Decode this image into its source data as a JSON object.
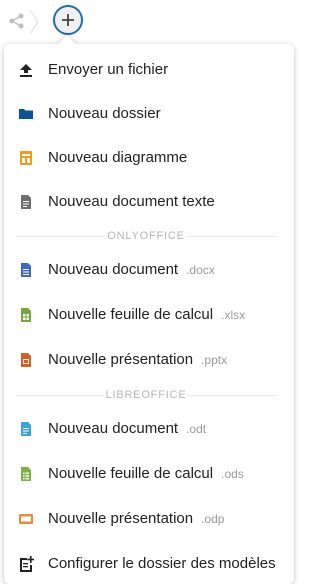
{
  "menu": {
    "items": [
      {
        "label": "Envoyer un fichier",
        "ext": "",
        "icon": "upload-icon"
      },
      {
        "label": "Nouveau dossier",
        "ext": "",
        "icon": "folder-icon"
      },
      {
        "label": "Nouveau diagramme",
        "ext": "",
        "icon": "diagram-icon"
      },
      {
        "label": "Nouveau document texte",
        "ext": "",
        "icon": "text-document-icon"
      }
    ],
    "onlyoffice_header": "ONLYOFFICE",
    "onlyoffice_items": [
      {
        "label": "Nouveau document",
        "ext": ".docx",
        "icon": "document-icon"
      },
      {
        "label": "Nouvelle feuille de calcul",
        "ext": ".xlsx",
        "icon": "spreadsheet-icon"
      },
      {
        "label": "Nouvelle présentation",
        "ext": ".pptx",
        "icon": "presentation-icon"
      }
    ],
    "libreoffice_header": "LIBREOFFICE",
    "libreoffice_items": [
      {
        "label": "Nouveau document",
        "ext": ".odt",
        "icon": "document-icon"
      },
      {
        "label": "Nouvelle feuille de calcul",
        "ext": ".ods",
        "icon": "spreadsheet-icon"
      },
      {
        "label": "Nouvelle présentation",
        "ext": ".odp",
        "icon": "presentation-icon"
      }
    ],
    "footer_item": {
      "label": "Configurer le dossier des modèles",
      "icon": "template-settings-icon"
    }
  },
  "colors": {
    "accent": "#1f6fa8",
    "folder": "#0b5394",
    "diagram": "#f29c1f",
    "onlyoffice_doc": "#3c6bbf",
    "onlyoffice_sheet": "#7aa53c",
    "onlyoffice_pres": "#d35f23",
    "libre_doc": "#3aa3db",
    "libre_sheet": "#7bb342",
    "libre_pres": "#f0883a"
  }
}
